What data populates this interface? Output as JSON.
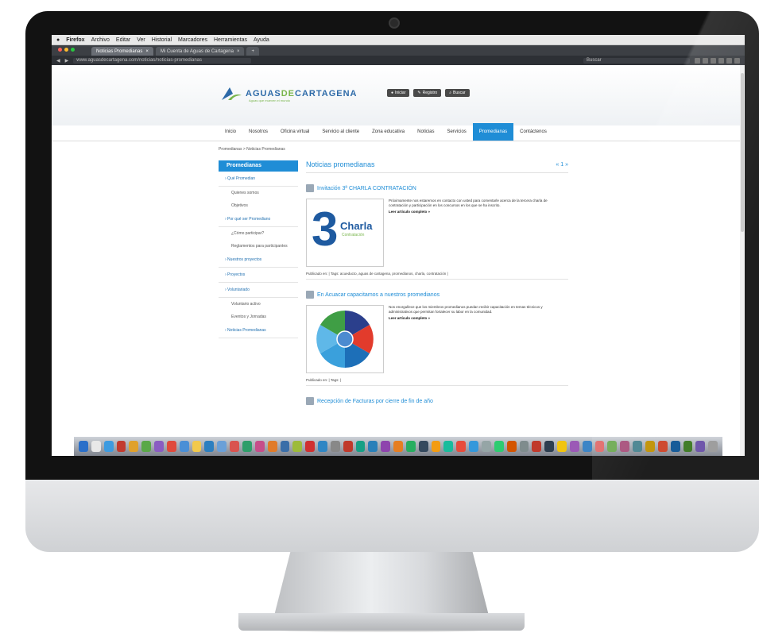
{
  "menubar": {
    "app": "Firefox",
    "items": [
      "Archivo",
      "Editar",
      "Ver",
      "Historial",
      "Marcadores",
      "Herramientas",
      "Ayuda"
    ],
    "clock": ""
  },
  "browser": {
    "tabs": [
      "Noticias Promedianas",
      "Mi Cuenta de Aguas de Cartagena"
    ],
    "url": "www.aguasdecartagena.com/noticias/noticias-promedianas",
    "search_placeholder": "Buscar"
  },
  "site": {
    "logo_main": "AGUAS",
    "logo_accent": "DE",
    "logo_end": "CARTAGENA",
    "logo_sub": "Aguas que mueven el mundo",
    "header_buttons": [
      "Iniciar",
      "Registro",
      "Buscar"
    ],
    "nav": [
      "Inicio",
      "Nosotros",
      "Oficina virtual",
      "Servicio al cliente",
      "Zona educativa",
      "Noticias",
      "Servicios",
      "Promedianas",
      "Contáctenos"
    ],
    "nav_active": "Promedianas",
    "breadcrumb": "Promedianas  >  Noticias Promedianas"
  },
  "sidebar": {
    "title": "Promedianas",
    "items": [
      {
        "label": "Qué Promedian",
        "type": "item"
      },
      {
        "label": "Quienes somos",
        "type": "sub"
      },
      {
        "label": "Objetivos",
        "type": "sub"
      },
      {
        "label": "Por qué ser Promediano",
        "type": "item"
      },
      {
        "label": "¿Cómo participar?",
        "type": "sub"
      },
      {
        "label": "Reglamentos para participantes",
        "type": "sub"
      },
      {
        "label": "Nuestros proyectos",
        "type": "item"
      },
      {
        "label": "Proyectos",
        "type": "item"
      },
      {
        "label": "Voluntariado",
        "type": "item"
      },
      {
        "label": "Voluntario activo",
        "type": "sub"
      },
      {
        "label": "Eventos y Jornadas",
        "type": "sub"
      },
      {
        "label": "Noticias Promedianas",
        "type": "item"
      }
    ]
  },
  "content": {
    "title": "Noticias promedianas",
    "pager": "« 1 »",
    "posts": [
      {
        "title": "Invitación 3ª CHARLA CONTRATACIÓN",
        "thumb_number": "3",
        "thumb_word": "Charla",
        "thumb_sub": "Contratación",
        "text": "Próximamente nos estaremos en contacto con usted para comentarle acerca de la tercera charla de contratación y participación en los concursos en los que se ha inscrito.",
        "more": "Leer artículo completo »",
        "tags": "Publicado en: | Tags: acueducto, aguas de cartagena, promedianos, charla, contratación |"
      },
      {
        "title": "En Acuacar capacitamos a nuestros promedianos",
        "text": "Nos enorgullece que los miembros promedianos puedan recibir capacitación en temas técnicos y administrativos que permitan fortalecer su labor en la comunidad.",
        "more": "Leer artículo completo »",
        "tags": "Publicado en: | Tags: |"
      },
      {
        "title": "Recepción de Facturas por cierre de fin de año",
        "text": "",
        "more": "",
        "tags": ""
      }
    ]
  },
  "colors": {
    "accent": "#1f8dd6",
    "logo_blue": "#2d6aa8",
    "logo_green": "#79b54c",
    "bezel": "#121212"
  },
  "dock": {
    "icons": [
      "#2a6fc9",
      "#e8e8e8",
      "#3d9be0",
      "#c23b2f",
      "#e0a12c",
      "#5aa848",
      "#8a5cc2",
      "#e04a3c",
      "#4a8fd6",
      "#f2c94c",
      "#2c7fc0",
      "#6aa0d8",
      "#d9534f",
      "#2e9e6a",
      "#c64d8a",
      "#e07b2a",
      "#3a6ea8",
      "#9dbb3a",
      "#d03030",
      "#2f86c4",
      "#888888",
      "#c0392b",
      "#16a085",
      "#2980b9",
      "#8e44ad",
      "#e67e22",
      "#27ae60",
      "#34495e",
      "#f39c12",
      "#1abc9c",
      "#e74c3c",
      "#3498db",
      "#95a5a6",
      "#2ecc71",
      "#d35400",
      "#7f8c8d",
      "#c0392b",
      "#2c3e50",
      "#f1c40f",
      "#9b59b6",
      "#3d85c6",
      "#e06666",
      "#6aa84f",
      "#a64d79",
      "#45818e",
      "#bf9000",
      "#cc4125",
      "#0b5394",
      "#38761d",
      "#674ea7",
      "#999999"
    ]
  }
}
